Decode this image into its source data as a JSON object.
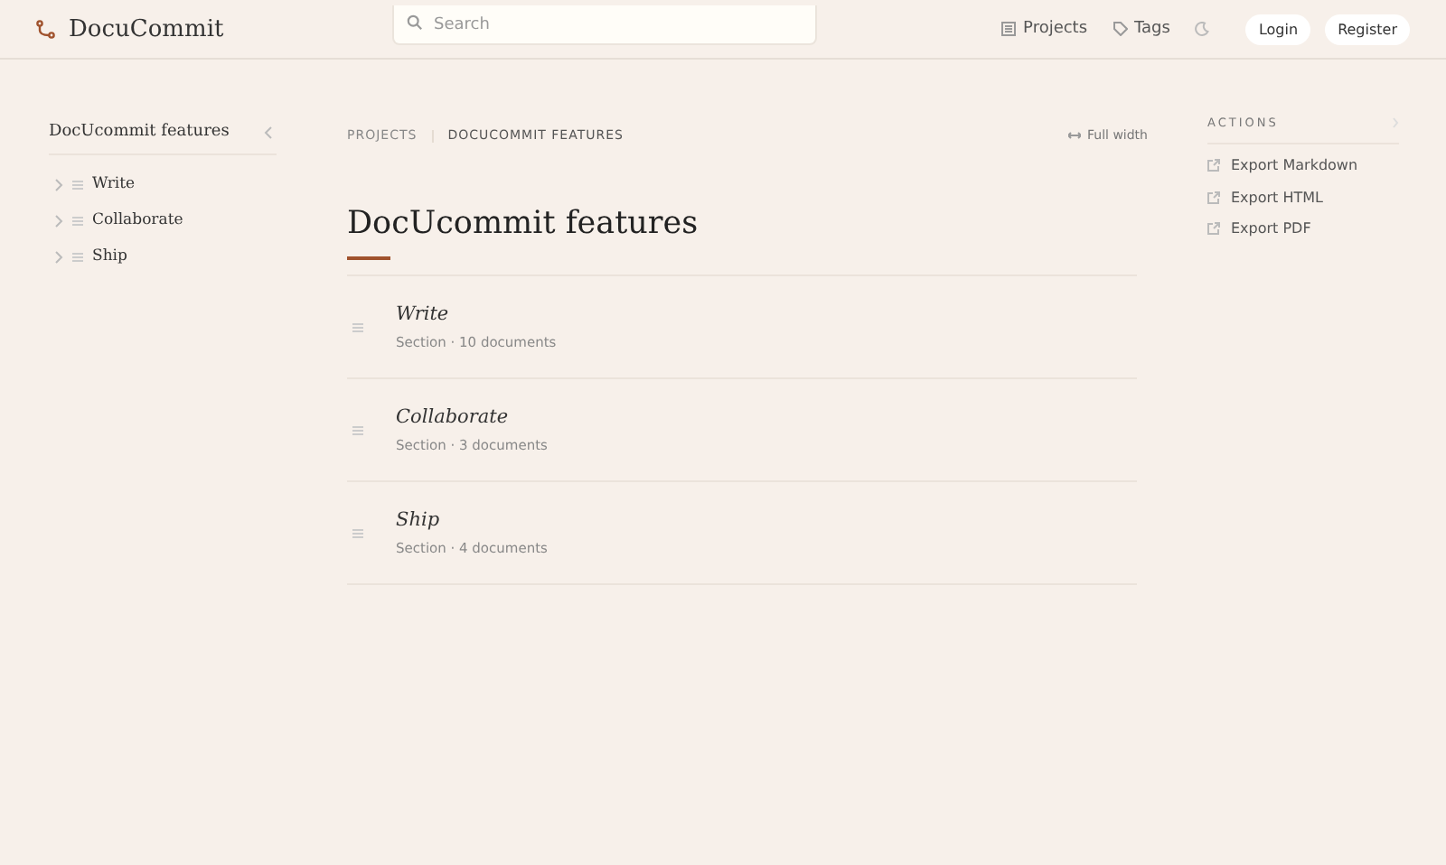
{
  "header": {
    "logo": "DocuCommit",
    "search": {
      "placeholder": "Search"
    },
    "nav": [
      {
        "label": "Projects",
        "kind": "projects"
      },
      {
        "label": "Tags",
        "kind": "tags"
      }
    ],
    "buttons": [
      "Login",
      "Register"
    ]
  },
  "sidebar": {
    "title": "DocUcommit features",
    "items": [
      {
        "label": "Write",
        "expanded": false
      },
      {
        "label": "Collaborate",
        "expanded": false
      },
      {
        "label": "Ship",
        "expanded": false
      }
    ]
  },
  "main": {
    "breadcrumbs": [
      "PROJECTS",
      "DOCUCOMMIT FEATURES"
    ],
    "width_toggle": "Full width",
    "title": "DocUcommit features",
    "sections": [
      {
        "title": "Write",
        "meta": "Section · 10 documents"
      },
      {
        "title": "Collaborate",
        "meta": "Section · 3 documents"
      },
      {
        "title": "Ship",
        "meta": "Section · 4 documents"
      }
    ]
  },
  "actions": {
    "heading": "ACTIONS",
    "items": [
      "Export Markdown",
      "Export HTML",
      "Export PDF"
    ]
  }
}
